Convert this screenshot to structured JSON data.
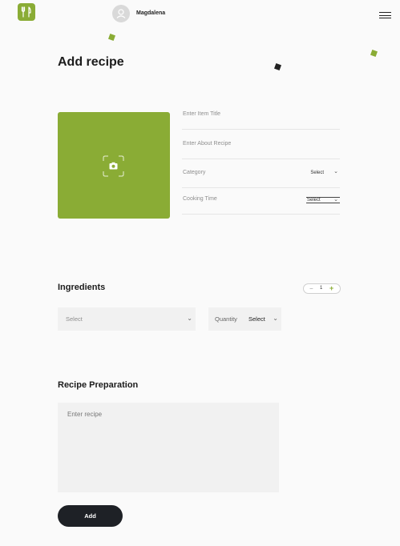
{
  "header": {
    "logo_icon": "fork-knife-icon",
    "user_name": "Magdalena",
    "avatar_icon": "user-icon",
    "menu_icon": "hamburger-menu-icon"
  },
  "page": {
    "title": "Add recipe"
  },
  "form": {
    "image_upload_icon": "camera-icon",
    "title_placeholder": "Enter Item Title",
    "about_placeholder": "Enter About Recipe",
    "category_label": "Category",
    "category_value": "Select",
    "cooking_time_label": "Cooking Time",
    "cooking_time_value": "Select"
  },
  "ingredients": {
    "title": "Ingredients",
    "stepper_minus": "−",
    "stepper_value": "1",
    "stepper_plus": "+",
    "ingredient_placeholder": "Select",
    "quantity_label": "Quantity",
    "quantity_value": "Select"
  },
  "preparation": {
    "title": "Recipe Preparation",
    "placeholder": "Enter recipe"
  },
  "actions": {
    "add_label": "Add"
  },
  "colors": {
    "accent": "#8aac35",
    "dark": "#1e2126",
    "background": "#fafafa"
  }
}
